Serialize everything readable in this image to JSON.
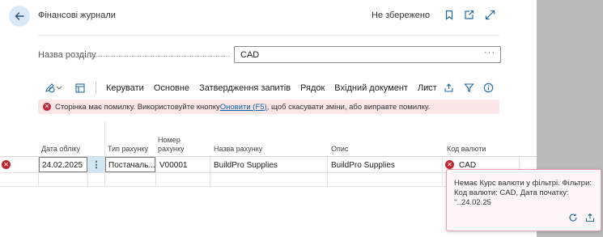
{
  "header": {
    "title": "Фінансові журнали",
    "save_status": "Не збережено"
  },
  "section_field": {
    "label": "Назва розділу",
    "value": "CAD",
    "more": "···"
  },
  "actions": [
    "Керувати",
    "Основне",
    "Затвердження запитів",
    "Рядок",
    "Вхідний документ",
    "Лист"
  ],
  "actions_more": "···",
  "error_banner": {
    "text_before": "Сторінка має помилку. Використовуйте кнопку ",
    "link": "Оновити (F5)",
    "text_after": ", щоб скасувати зміни, або виправте помилку."
  },
  "columns": {
    "posting_date": "Дата обліку",
    "account_type": "Тип рахунку",
    "account_no_line1": "Номер",
    "account_no_line2": "рахунку",
    "account_name": "Назва рахунку",
    "description": "Опис",
    "currency_code": "Код валюти"
  },
  "row": {
    "posting_date": "24.02.2025",
    "account_type": "Постачаль...",
    "account_no": "V00001",
    "account_name": "BuildPro Supplies",
    "description": "BuildPro Supplies",
    "currency_code": "CAD"
  },
  "tooltip": {
    "line1": "Немає Курс валюти у фільтрі. Фільтри:",
    "line2": "Код валюти: CAD, Дата початку:",
    "line3": "''..24.02.25"
  },
  "colors": {
    "accent": "#0a5fa6",
    "error": "#c0242f",
    "error_bg": "#fbe5e6",
    "selected_cell": "#cfe7f2"
  }
}
